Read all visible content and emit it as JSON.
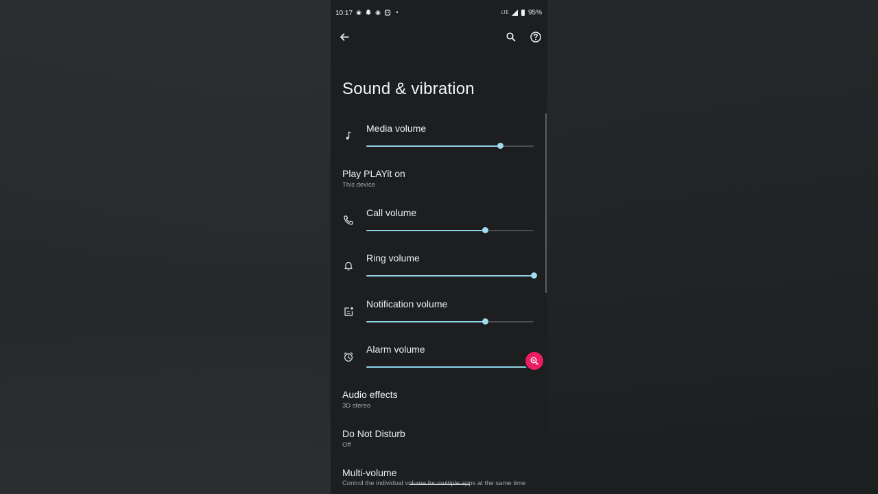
{
  "status_bar": {
    "time": "10:17",
    "notification_icons": [
      "screen-record-icon",
      "snapchat-icon",
      "screen-record-icon",
      "alarm-app-icon",
      "dot-icon"
    ],
    "network": "LTE",
    "battery": "95%"
  },
  "toolbar": {
    "back_icon": "arrow-left-icon",
    "search_icon": "search-icon",
    "help_icon": "help-circle-icon"
  },
  "page": {
    "title": "Sound & vibration"
  },
  "settings": {
    "media_volume": {
      "label": "Media volume",
      "level": 0.8,
      "icon": "music-note-icon"
    },
    "play_on": {
      "label": "Play PLAYit on",
      "value": "This device"
    },
    "call_volume": {
      "label": "Call volume",
      "level": 0.71,
      "icon": "phone-icon"
    },
    "ring_volume": {
      "label": "Ring volume",
      "level": 1.0,
      "icon": "bell-icon"
    },
    "notification_volume": {
      "label": "Notification volume",
      "level": 0.71,
      "icon": "notification-icon"
    },
    "alarm_volume": {
      "label": "Alarm volume",
      "level": 1.0,
      "icon": "alarm-icon"
    },
    "audio_effects": {
      "label": "Audio effects",
      "value": "3D stereo"
    },
    "do_not_disturb": {
      "label": "Do Not Disturb",
      "value": "Off"
    },
    "multi_volume": {
      "label": "Multi-volume",
      "value": "Control the individual volume for multiple apps at the same time"
    }
  },
  "colors": {
    "accent": "#8fd3e6",
    "fab": "#ea1e61",
    "surface": "#1c1e1f"
  },
  "fab": {
    "icon": "zoom-in-icon"
  }
}
